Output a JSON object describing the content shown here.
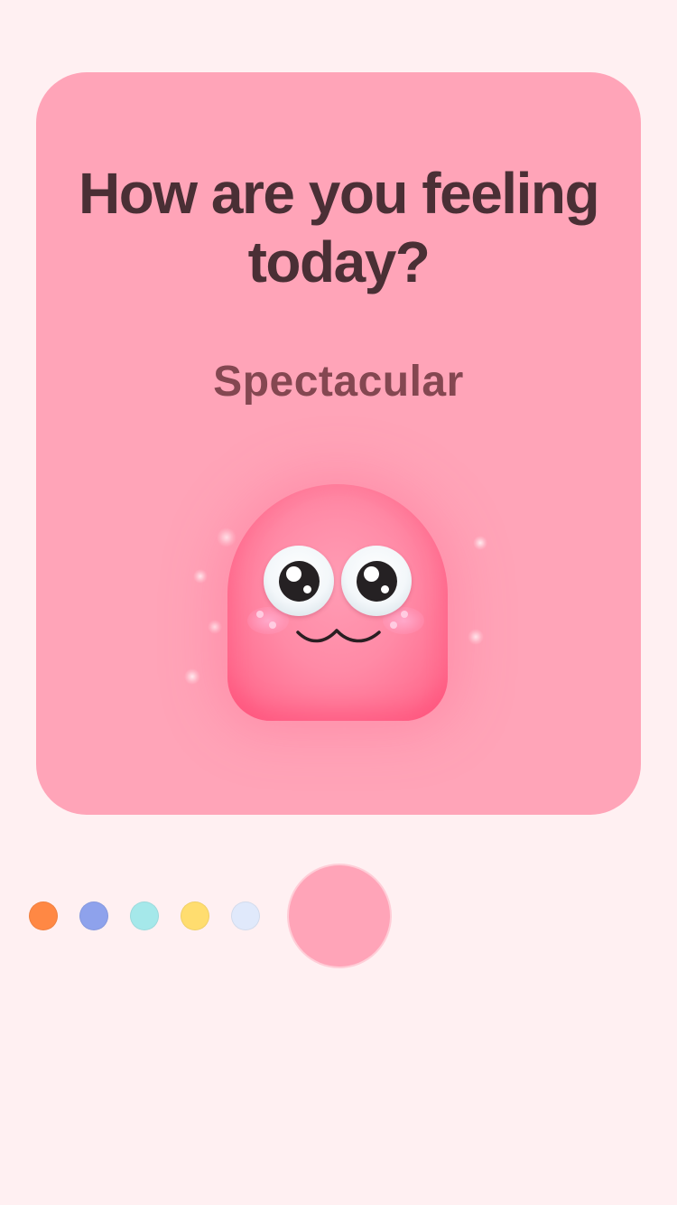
{
  "question": "How are you feeling\ntoday?",
  "mood_label": "Spectacular",
  "mascot": {
    "name": "pink-blob-mascot",
    "mood": "spectacular"
  },
  "colors": {
    "page_background": "#fff0f2",
    "card_background": "#ffa4b8",
    "question_text": "#4a2f35",
    "mood_text": "#7a4049"
  },
  "mood_selector": {
    "options": [
      {
        "color": "#ff8844",
        "selected": false
      },
      {
        "color": "#8ea2ec",
        "selected": false
      },
      {
        "color": "#a5e8ea",
        "selected": false
      },
      {
        "color": "#ffdd6f",
        "selected": false
      },
      {
        "color": "#e0e9fb",
        "selected": false
      },
      {
        "color": "#ffa4b8",
        "selected": true
      }
    ]
  }
}
